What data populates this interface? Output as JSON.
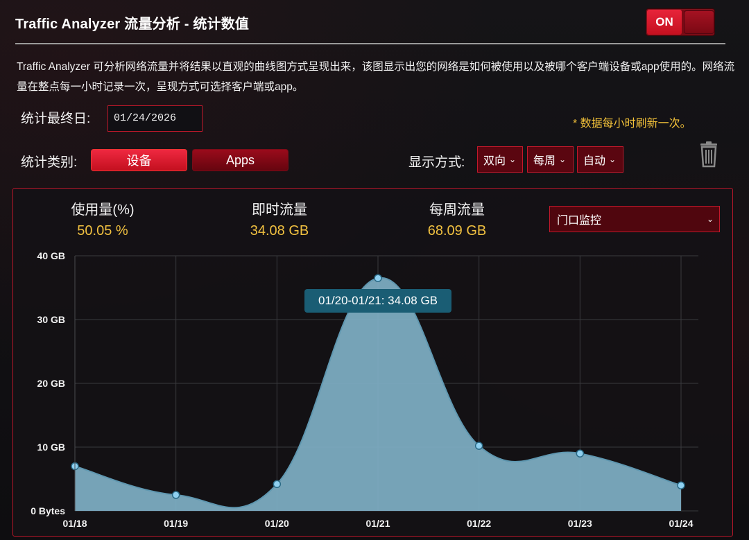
{
  "header": {
    "title": "Traffic Analyzer 流量分析 - 统计数值",
    "toggle_label": "ON"
  },
  "description": "Traffic Analyzer 可分析网络流量并将结果以直观的曲线图方式呈现出来，该图显示出您的网络是如何被使用以及被哪个客户端设备或app使用的。网络流量在整点每一小时记录一次，呈现方式可选择客户端或app。",
  "controls": {
    "end_date_label": "统计最终日:",
    "end_date_value": "01/24/2026",
    "refresh_note": "* 数据每小时刷新一次。",
    "category_label": "统计类别:",
    "category_device": "设备",
    "category_apps": "Apps",
    "display_label": "显示方式:",
    "direction_value": "双向",
    "period_value": "每周",
    "mode_value": "自动"
  },
  "stats": {
    "usage_label": "使用量(%)",
    "usage_value": "50.05 %",
    "realtime_label": "即时流量",
    "realtime_value": "34.08 GB",
    "weekly_label": "每周流量",
    "weekly_value": "68.09 GB",
    "monitor_value": "门口监控"
  },
  "tooltip": "01/20-01/21: 34.08 GB",
  "colors": {
    "accent_red": "#c2182b",
    "value_gold": "#f0c040",
    "area_fill": "#7fb0c5",
    "point": "#8fd0f0"
  },
  "icons": {
    "trash": "trash-icon",
    "chevron": "chevron-down-icon"
  },
  "chart_data": {
    "type": "area",
    "x": [
      "01/18",
      "01/19",
      "01/20",
      "01/21",
      "01/22",
      "01/23",
      "01/24"
    ],
    "values": [
      7,
      2.5,
      4.2,
      36.5,
      10.2,
      9,
      4
    ],
    "ytick_labels": [
      "0 Bytes",
      "10 GB",
      "20 GB",
      "30 GB",
      "40 GB"
    ],
    "yticks": [
      0,
      10,
      20,
      30,
      40
    ],
    "ylim": [
      0,
      40
    ],
    "grid": true
  }
}
